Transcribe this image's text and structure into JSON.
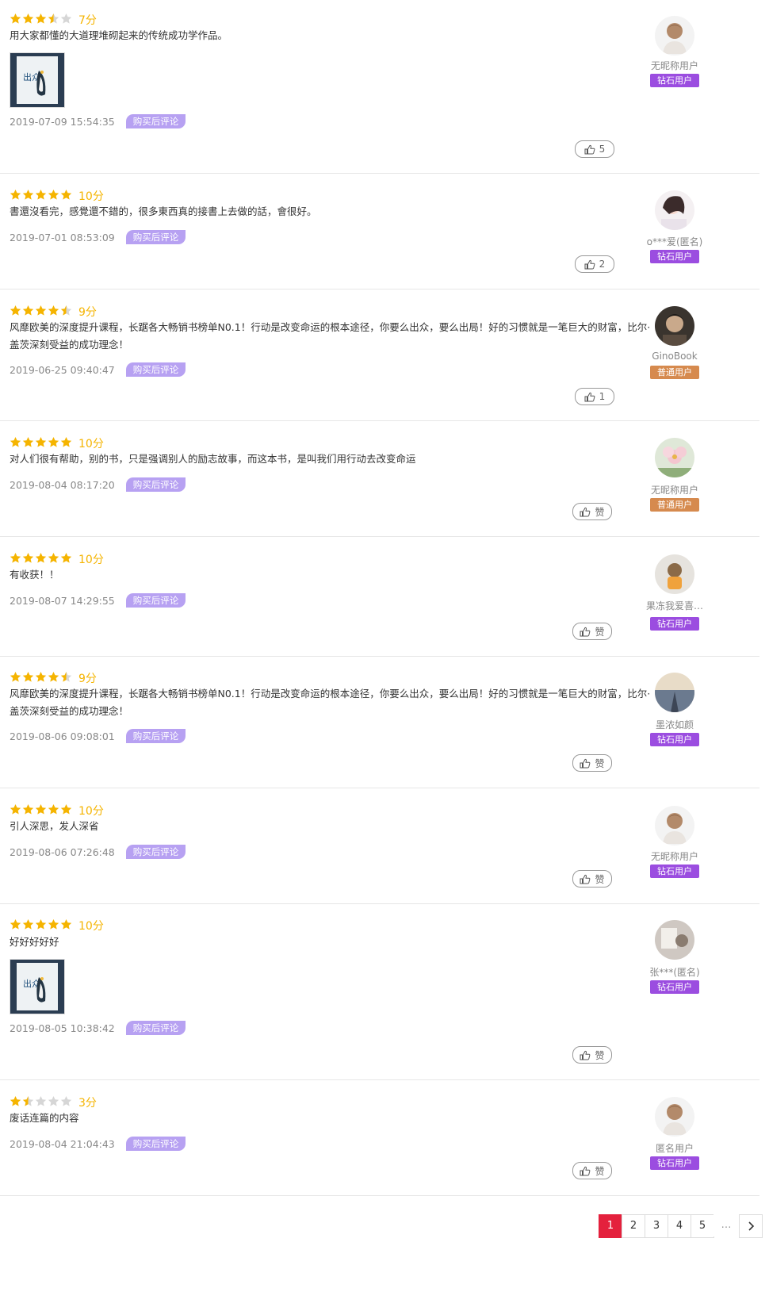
{
  "colors": {
    "star_on": "#f5b400",
    "star_off": "#d6d6d6",
    "accent_page": "#e4213d",
    "badge_bought": "#b7a1f2",
    "level_diamond": "#9b4de0",
    "level_normal": "#d68a4e"
  },
  "reviews": [
    {
      "stars": 3.5,
      "score": "7分",
      "text": "用大家都懂的大道理堆砌起来的传统成功学作品。",
      "date": "2019-07-09 15:54:35",
      "badge": "购买后评论",
      "likes": "5",
      "user": "无昵称用户",
      "level": "钻石用户",
      "level_type": "diamond",
      "avatar": "default-avatar",
      "has_image": true
    },
    {
      "stars": 5,
      "score": "10分",
      "text": "書還沒看完，感覺還不錯的，很多東西真的接書上去做的話，會很好。",
      "date": "2019-07-01 08:53:09",
      "badge": "购买后评论",
      "likes": "2",
      "user": "o***爱(匿名)",
      "level": "钻石用户",
      "level_type": "diamond",
      "avatar": "girl-avatar",
      "has_image": false
    },
    {
      "stars": 4.5,
      "score": "9分",
      "text": "风靡欧美的深度提升课程，长踞各大畅销书榜单N0.1！行动是改变命运的根本途径，你要么出众，要么出局！好的习惯就是一笔巨大的财富，比尔·盖茨深刻受益的成功理念！",
      "date": "2019-06-25 09:40:47",
      "badge": "购买后评论",
      "likes": "1",
      "user": "GinoBook",
      "level": "普通用户",
      "level_type": "normal",
      "avatar": "dark-avatar",
      "has_image": false
    },
    {
      "stars": 5,
      "score": "10分",
      "text": "对人们很有帮助，别的书，只是强调别人的励志故事，而这本书，是叫我们用行动去改变命运",
      "date": "2019-08-04 08:17:20",
      "badge": "购买后评论",
      "likes": "赞",
      "user": "无昵称用户",
      "level": "普通用户",
      "level_type": "normal",
      "avatar": "flower-avatar",
      "has_image": false
    },
    {
      "stars": 5,
      "score": "10分",
      "text": "有收获！！",
      "date": "2019-08-07 14:29:55",
      "badge": "购买后评论",
      "likes": "赞",
      "user": "果冻我爱喜…",
      "level": "钻石用户",
      "level_type": "diamond",
      "avatar": "toy-avatar",
      "has_image": false
    },
    {
      "stars": 4.5,
      "score": "9分",
      "text": "风靡欧美的深度提升课程，长踞各大畅销书榜单N0.1！行动是改变命运的根本途径，你要么出众，要么出局！好的习惯就是一笔巨大的财富，比尔·盖茨深刻受益的成功理念！",
      "date": "2019-08-06 09:08:01",
      "badge": "购买后评论",
      "likes": "赞",
      "user": "墨浓如颜",
      "level": "钻石用户",
      "level_type": "diamond",
      "avatar": "road-avatar",
      "has_image": false
    },
    {
      "stars": 5,
      "score": "10分",
      "text": "引人深思，发人深省",
      "date": "2019-08-06 07:26:48",
      "badge": "购买后评论",
      "likes": "赞",
      "user": "无昵称用户",
      "level": "钻石用户",
      "level_type": "diamond",
      "avatar": "default-avatar",
      "has_image": false
    },
    {
      "stars": 5,
      "score": "10分",
      "text": "好好好好好",
      "date": "2019-08-05 10:38:42",
      "badge": "购买后评论",
      "likes": "赞",
      "user": "张***(匿名)",
      "level": "钻石用户",
      "level_type": "diamond",
      "avatar": "photo-avatar",
      "has_image": true
    },
    {
      "stars": 1.5,
      "score": "3分",
      "text": "废话连篇的内容",
      "date": "2019-08-04 21:04:43",
      "badge": "购买后评论",
      "likes": "赞",
      "user": "匿名用户",
      "level": "钻石用户",
      "level_type": "diamond",
      "avatar": "default-avatar",
      "has_image": false
    }
  ],
  "pagination": {
    "pages": [
      "1",
      "2",
      "3",
      "4",
      "5"
    ],
    "active": "1",
    "ellipsis": "…",
    "next_icon": "chevron-right-icon"
  }
}
